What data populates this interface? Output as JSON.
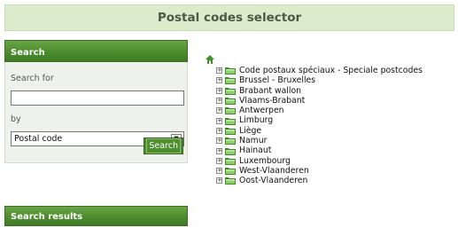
{
  "header": {
    "title": "Postal codes selector"
  },
  "search_panel": {
    "title": "Search",
    "search_for_label": "Search for",
    "search_for_value": "",
    "by_label": "by",
    "by_selected": "Postal code",
    "button_label": "Search"
  },
  "results_panel": {
    "title": "Search results"
  },
  "tree": {
    "items": [
      {
        "label": "Code postaux spéciaux - Speciale postcodes"
      },
      {
        "label": "Brussel - Bruxelles"
      },
      {
        "label": "Brabant wallon"
      },
      {
        "label": "Vlaams-Brabant"
      },
      {
        "label": "Antwerpen"
      },
      {
        "label": "Limburg"
      },
      {
        "label": "Liège"
      },
      {
        "label": "Namur"
      },
      {
        "label": "Hainaut"
      },
      {
        "label": "Luxembourg"
      },
      {
        "label": "West-Vlaanderen"
      },
      {
        "label": "Oost-Vlaanderen"
      }
    ]
  },
  "colors": {
    "accent": "#4f8e30",
    "header_bg": "#dcebcb",
    "panel_bg": "#eff2ec"
  }
}
